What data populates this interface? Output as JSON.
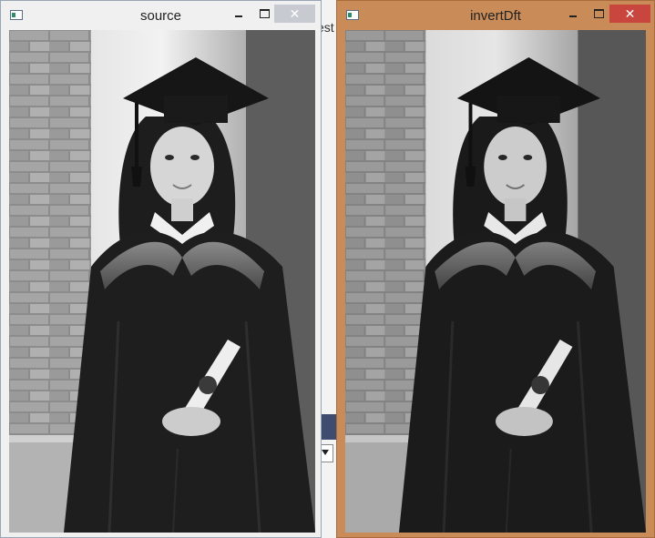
{
  "background": {
    "partial_text": "est"
  },
  "windows": [
    {
      "id": "source",
      "title": "source",
      "close_glyph": "✕",
      "icons": [
        "app-window-icon",
        "minimize-icon",
        "maximize-icon",
        "close-icon"
      ],
      "image": "grayscale graduation portrait",
      "accent": "#f0f0f0"
    },
    {
      "id": "invertDft",
      "title": "invertDft",
      "close_glyph": "✕",
      "icons": [
        "app-window-icon",
        "minimize-icon",
        "maximize-icon",
        "close-icon"
      ],
      "image": "grayscale graduation portrait (inverse DFT result)",
      "accent": "#c98b57"
    }
  ]
}
